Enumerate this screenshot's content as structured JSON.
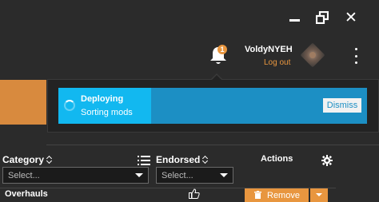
{
  "window": {
    "minimize_icon": "minimize-icon",
    "restore_icon": "restore-icon",
    "close_icon": "close-icon",
    "close_glyph": "✕"
  },
  "header": {
    "notification_count": "1",
    "username": "VoldyNYEH",
    "logout_label": "Log out",
    "accent_color": "#e8963f"
  },
  "notification": {
    "title": "Deploying",
    "message": "Sorting mods",
    "dismiss_label": "Dismiss",
    "progress_fraction": 0.3,
    "bar_color": "#1c8fc4",
    "progress_color": "#12b8f0"
  },
  "filters": {
    "category_label": "Category",
    "category_placeholder": "Select...",
    "endorsed_label": "Endorsed",
    "endorsed_placeholder": "Select...",
    "actions_label": "Actions"
  },
  "mods": [
    {
      "name": "Overhauls",
      "action_label": "Remove"
    }
  ]
}
